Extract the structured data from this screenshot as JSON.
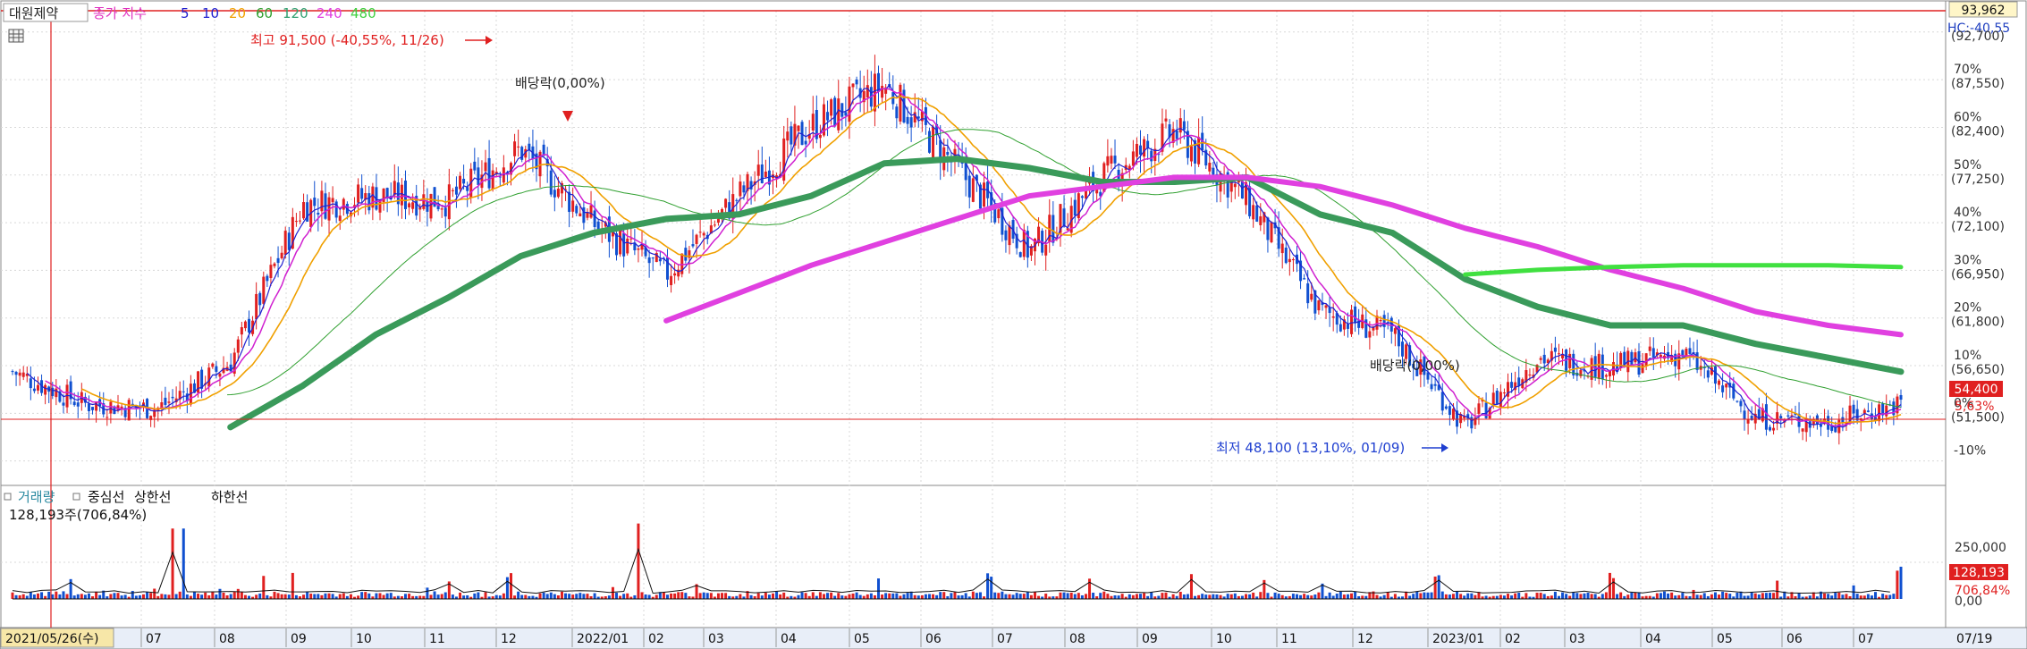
{
  "legend": {
    "stock_name": "대원제약",
    "indicator": "종가 지수",
    "ma_periods": [
      {
        "label": "5",
        "color": "#2020d0"
      },
      {
        "label": "10",
        "color": "#2020d0"
      },
      {
        "label": "20",
        "color": "#f0a000"
      },
      {
        "label": "60",
        "color": "#30a030"
      },
      {
        "label": "120",
        "color": "#30a070"
      },
      {
        "label": "240",
        "color": "#e040e0"
      },
      {
        "label": "480",
        "color": "#40e040"
      }
    ]
  },
  "volume_legend": {
    "items": [
      "거래량",
      "중심선",
      "상한선",
      "하한선"
    ],
    "current_text": "128,193주(706,84%)"
  },
  "annotations": {
    "high": "최고 91,500 (-40,55%, 11/26)",
    "dividend1": "배당락(0,00%)",
    "dividend2": "배당락(0,00%)",
    "low": "최저 48,100 (13,10%, 01/09)"
  },
  "right_axis": {
    "top_price": "93,962",
    "hc_label": "HC:-40,55",
    "ticks": [
      {
        "pct": "",
        "price": "(92,700)",
        "pv": 92700
      },
      {
        "pct": "70%",
        "price": "(87,550)",
        "pv": 87550
      },
      {
        "pct": "60%",
        "price": "(82,400)",
        "pv": 82400
      },
      {
        "pct": "50%",
        "price": "(77,250)",
        "pv": 77250
      },
      {
        "pct": "40%",
        "price": "(72,100)",
        "pv": 72100
      },
      {
        "pct": "30%",
        "price": "(66,950)",
        "pv": 66950
      },
      {
        "pct": "20%",
        "price": "(61,800)",
        "pv": 61800
      },
      {
        "pct": "10%",
        "price": "(56,650)",
        "pv": 56650
      },
      {
        "pct": "0%",
        "price": "(51,500)",
        "pv": 51500
      },
      {
        "pct": "-10%",
        "price": "",
        "pv": 46350
      }
    ],
    "current_price": "54,400",
    "current_pct": "5,63%",
    "volume_ticks": [
      "250,000",
      "0,00"
    ],
    "volume_current": "128,193",
    "volume_pct": "706,84%"
  },
  "x_axis": {
    "start_label": "2021/05/26(수)",
    "end_label": "07/19",
    "labels": [
      {
        "text": "07",
        "x": 163
      },
      {
        "text": "08",
        "x": 245
      },
      {
        "text": "09",
        "x": 325
      },
      {
        "text": "10",
        "x": 398
      },
      {
        "text": "11",
        "x": 480
      },
      {
        "text": "12",
        "x": 560
      },
      {
        "text": "2022/01",
        "x": 645
      },
      {
        "text": "02",
        "x": 725
      },
      {
        "text": "03",
        "x": 792
      },
      {
        "text": "04",
        "x": 873
      },
      {
        "text": "05",
        "x": 955
      },
      {
        "text": "06",
        "x": 1035
      },
      {
        "text": "07",
        "x": 1115
      },
      {
        "text": "08",
        "x": 1196
      },
      {
        "text": "09",
        "x": 1277
      },
      {
        "text": "10",
        "x": 1360
      },
      {
        "text": "11",
        "x": 1433
      },
      {
        "text": "12",
        "x": 1518
      },
      {
        "text": "2023/01",
        "x": 1602
      },
      {
        "text": "02",
        "x": 1683
      },
      {
        "text": "03",
        "x": 1755
      },
      {
        "text": "04",
        "x": 1840
      },
      {
        "text": "05",
        "x": 1920
      },
      {
        "text": "06",
        "x": 1998
      },
      {
        "text": "07",
        "x": 2078
      }
    ]
  },
  "chart_data": {
    "type": "line",
    "base_price": 51500,
    "price_axis": {
      "min": 44000,
      "max": 95000
    },
    "x": [
      "2021/05",
      "2021/06",
      "2021/07",
      "2021/08",
      "2021/09",
      "2021/10",
      "2021/11",
      "2021/12",
      "2022/01",
      "2022/02",
      "2022/03",
      "2022/04",
      "2022/05",
      "2022/06",
      "2022/07",
      "2022/08",
      "2022/09",
      "2022/10",
      "2022/11",
      "2022/12",
      "2023/01",
      "2023/02",
      "2023/03",
      "2023/04",
      "2023/05",
      "2023/06",
      "2023/07"
    ],
    "series": [
      {
        "name": "종가",
        "values": [
          56000,
          52500,
          52000,
          57000,
          74000,
          75000,
          74500,
          80000,
          72000,
          66500,
          75000,
          82500,
          87000,
          78000,
          69000,
          77000,
          82000,
          74500,
          62500,
          60000,
          50000,
          57500,
          56500,
          58000,
          51000,
          50500,
          52500
        ]
      },
      {
        "name": "120",
        "values": [
          null,
          null,
          null,
          50000,
          54500,
          60000,
          64000,
          68500,
          71000,
          72500,
          73000,
          75000,
          78500,
          79000,
          78000,
          76500,
          76500,
          77000,
          73000,
          71000,
          66000,
          63000,
          61000,
          61000,
          59000,
          57500,
          56000
        ]
      },
      {
        "name": "240",
        "values": [
          null,
          null,
          null,
          null,
          null,
          null,
          null,
          null,
          null,
          61500,
          64500,
          67500,
          70000,
          72500,
          75000,
          76000,
          77000,
          77000,
          76000,
          74000,
          71500,
          69500,
          67000,
          65000,
          62500,
          61000,
          60000
        ]
      },
      {
        "name": "480",
        "values": [
          null,
          null,
          null,
          null,
          null,
          null,
          null,
          null,
          null,
          null,
          null,
          null,
          null,
          null,
          null,
          null,
          null,
          null,
          null,
          null,
          66500,
          67000,
          67300,
          67500,
          67500,
          67500,
          67300
        ]
      }
    ],
    "volume": {
      "max": 320000,
      "last": 128193
    }
  },
  "colors": {
    "up": "#e02020",
    "down": "#1050d0",
    "ma5": "#2020d0",
    "ma10": "#d020d0",
    "ma20": "#f0a000",
    "ma60": "#30a030",
    "ma120": "#3a9a5a",
    "ma240": "#e040e0",
    "ma480": "#40e040",
    "price_tag_bg": "#e02020"
  }
}
